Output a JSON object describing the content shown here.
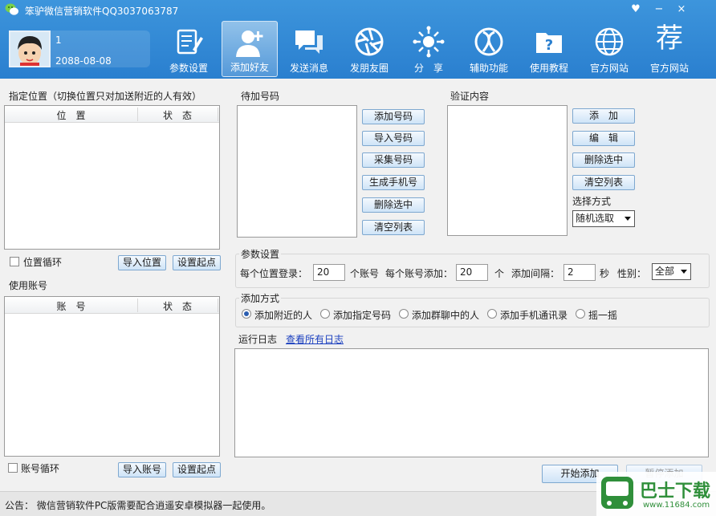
{
  "window": {
    "title": "笨驴微信营销软件QQ3037063787",
    "controls": [
      "♥",
      "−",
      "×"
    ]
  },
  "user": {
    "id": "1",
    "expiry": "2088-08-08"
  },
  "nav": [
    {
      "label": "参数设置",
      "icon": "settings-icon",
      "active": false
    },
    {
      "label": "添加好友",
      "icon": "add-friend-icon",
      "active": true
    },
    {
      "label": "发送消息",
      "icon": "message-icon",
      "active": false
    },
    {
      "label": "发朋友圈",
      "icon": "moments-icon",
      "active": false
    },
    {
      "label": "分　享",
      "icon": "share-icon",
      "active": false
    },
    {
      "label": "辅助功能",
      "icon": "assist-icon",
      "active": false
    },
    {
      "label": "使用教程",
      "icon": "tutorial-icon",
      "active": false
    },
    {
      "label": "官方网站",
      "icon": "globe-icon",
      "active": false
    },
    {
      "label": "官方网站",
      "icon": "recommend-icon",
      "active": false,
      "glyph": "荐"
    }
  ],
  "location": {
    "title": "指定位置（切换位置只对加送附近的人有效）",
    "columns": [
      "位　置",
      "状　态"
    ],
    "loop_label": "位置循环",
    "import_button": "导入位置",
    "set_start_button": "设置起点"
  },
  "accounts": {
    "title": "使用账号",
    "columns": [
      "账　号",
      "状　态"
    ],
    "loop_label": "账号循环",
    "import_button": "导入账号",
    "set_start_button": "设置起点"
  },
  "pending": {
    "title": "待加号码",
    "buttons": [
      "添加号码",
      "导入号码",
      "采集号码",
      "生成手机号",
      "删除选中",
      "清空列表"
    ]
  },
  "verify": {
    "title": "验证内容",
    "buttons": [
      "添　加",
      "编　辑",
      "删除选中",
      "清空列表"
    ],
    "mode_label": "选择方式",
    "mode_value": "随机选取"
  },
  "params": {
    "title": "参数设置",
    "per_location_label": "每个位置登录：",
    "per_location_value": "20",
    "per_location_unit": "个账号",
    "per_account_label": "每个账号添加：",
    "per_account_value": "20",
    "per_account_unit": "个",
    "interval_label": "添加间隔：",
    "interval_value": "2",
    "interval_unit": "秒",
    "gender_label": "性别：",
    "gender_value": "全部"
  },
  "add_mode": {
    "title": "添加方式",
    "options": [
      "添加附近的人",
      "添加指定号码",
      "添加群聊中的人",
      "添加手机通讯录",
      "摇一摇"
    ],
    "selected_index": 0
  },
  "log": {
    "title": "运行日志",
    "link": "查看所有日志"
  },
  "actions": {
    "start": "开始添加",
    "pause": "暂停添加"
  },
  "footer": {
    "notice": "公告：  微信营销软件PC版需要配合逍遥安卓模拟器一起使用。"
  },
  "watermark": {
    "text": "巴士下载",
    "url": "www.11684.com"
  }
}
